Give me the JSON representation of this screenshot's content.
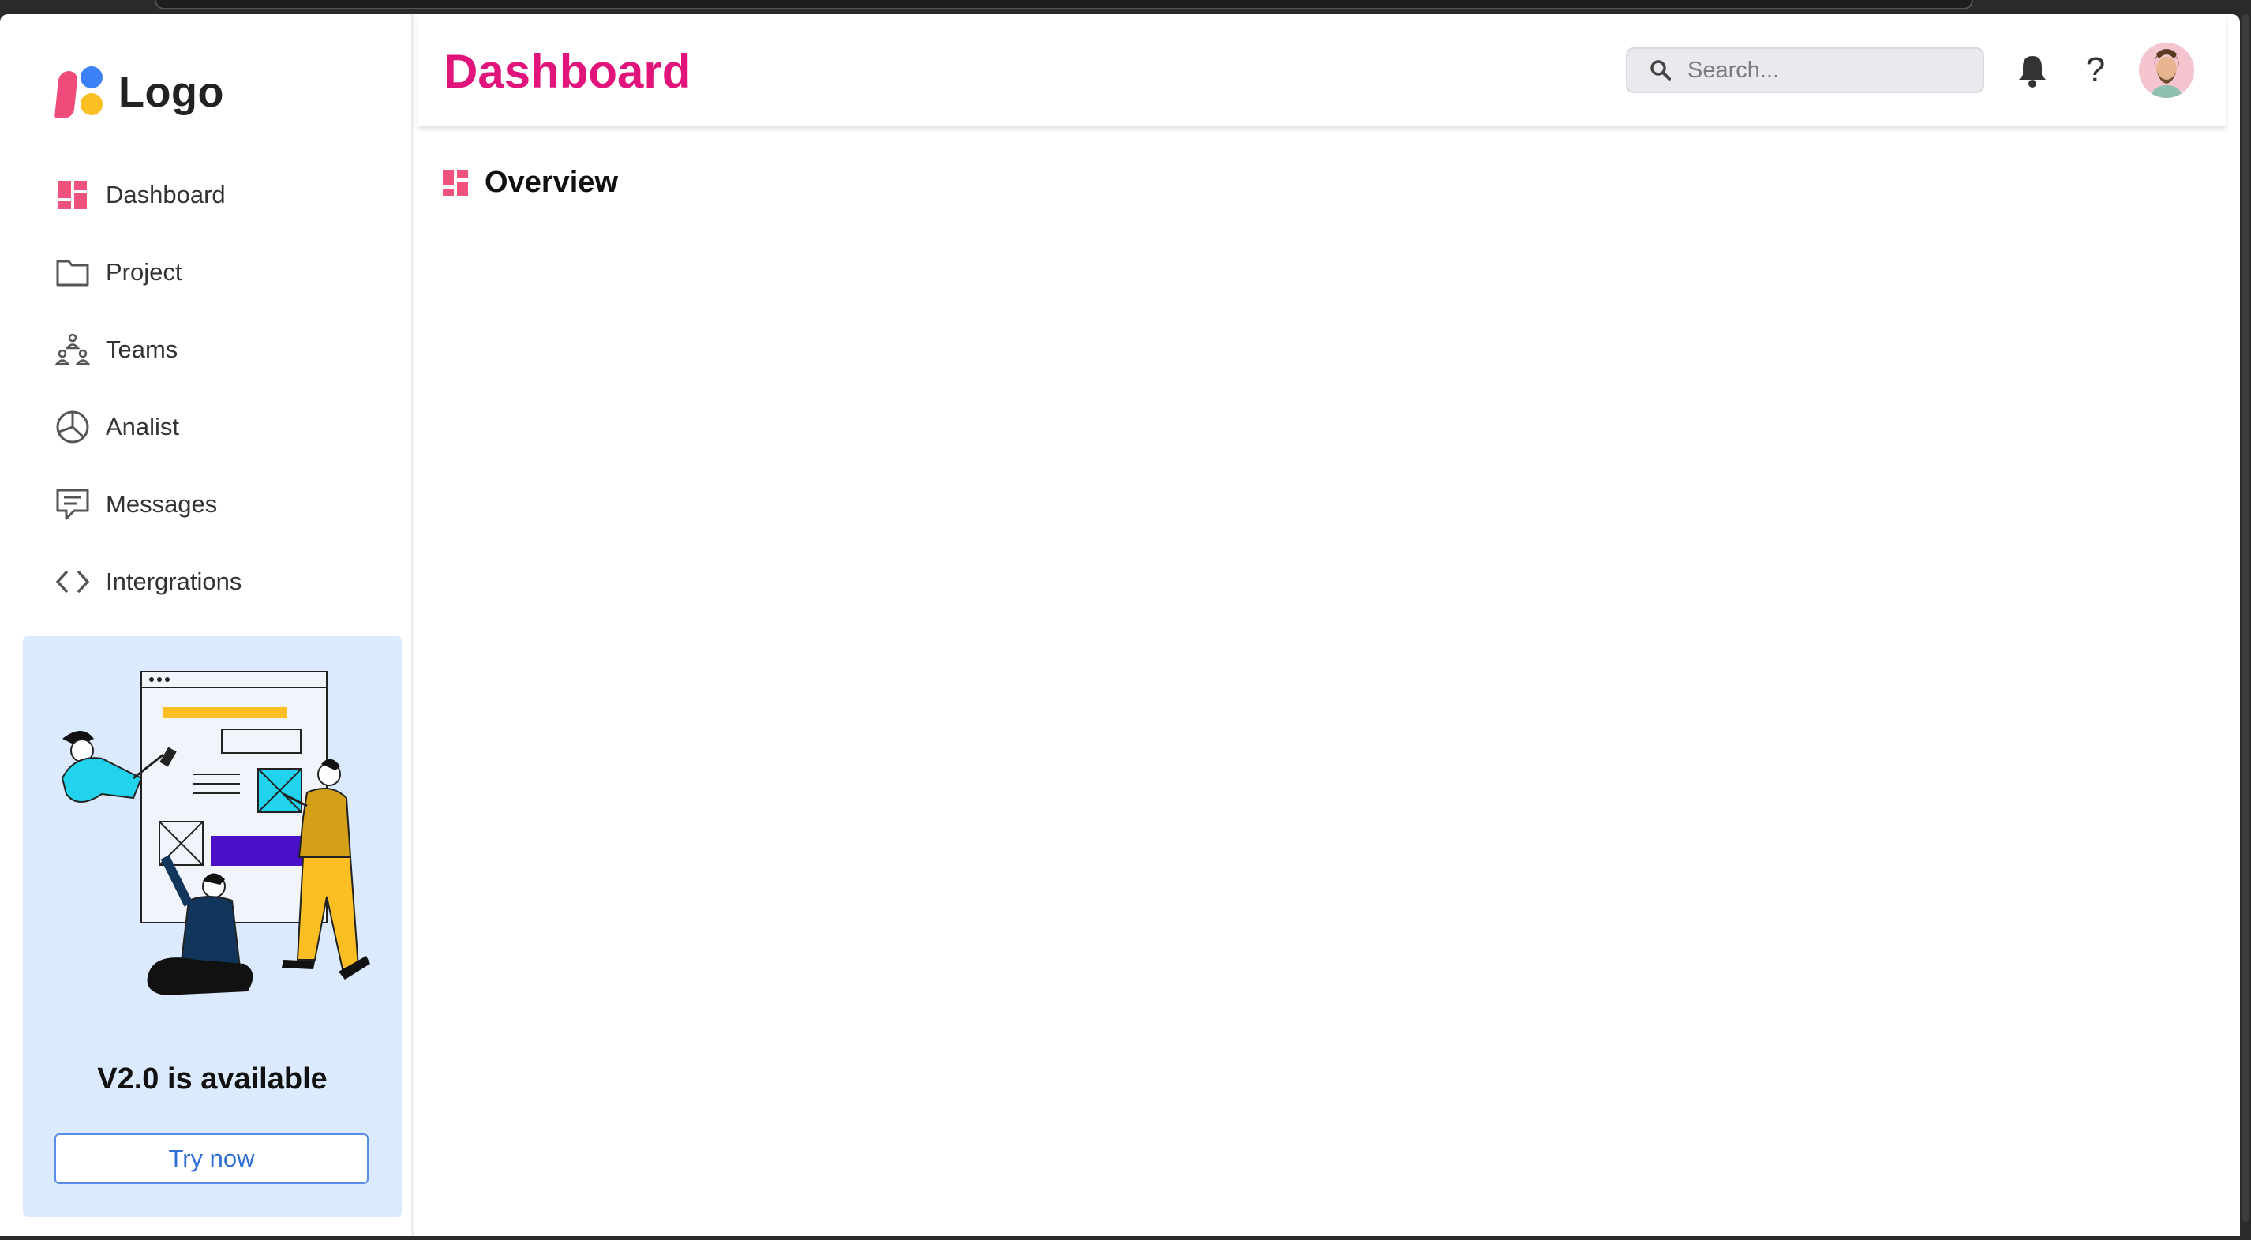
{
  "sidebar": {
    "logo_text": "Logo",
    "nav": [
      {
        "label": "Dashboard",
        "icon": "dashboard-icon"
      },
      {
        "label": "Project",
        "icon": "folder-icon"
      },
      {
        "label": "Teams",
        "icon": "teams-icon"
      },
      {
        "label": "Analist",
        "icon": "pie-chart-icon"
      },
      {
        "label": "Messages",
        "icon": "message-icon"
      },
      {
        "label": "Intergrations",
        "icon": "code-icon"
      }
    ],
    "promo": {
      "title": "V2.0 is available",
      "button_label": "Try now"
    }
  },
  "header": {
    "title": "Dashboard",
    "search": {
      "placeholder": "Search...",
      "value": ""
    },
    "help_glyph": "?"
  },
  "main": {
    "section_title": "Overview"
  },
  "colors": {
    "accent": "#e0147a",
    "icon_pink": "#f0527e",
    "promo_bg": "#dbeafe",
    "button_border": "#5a8ee6"
  }
}
